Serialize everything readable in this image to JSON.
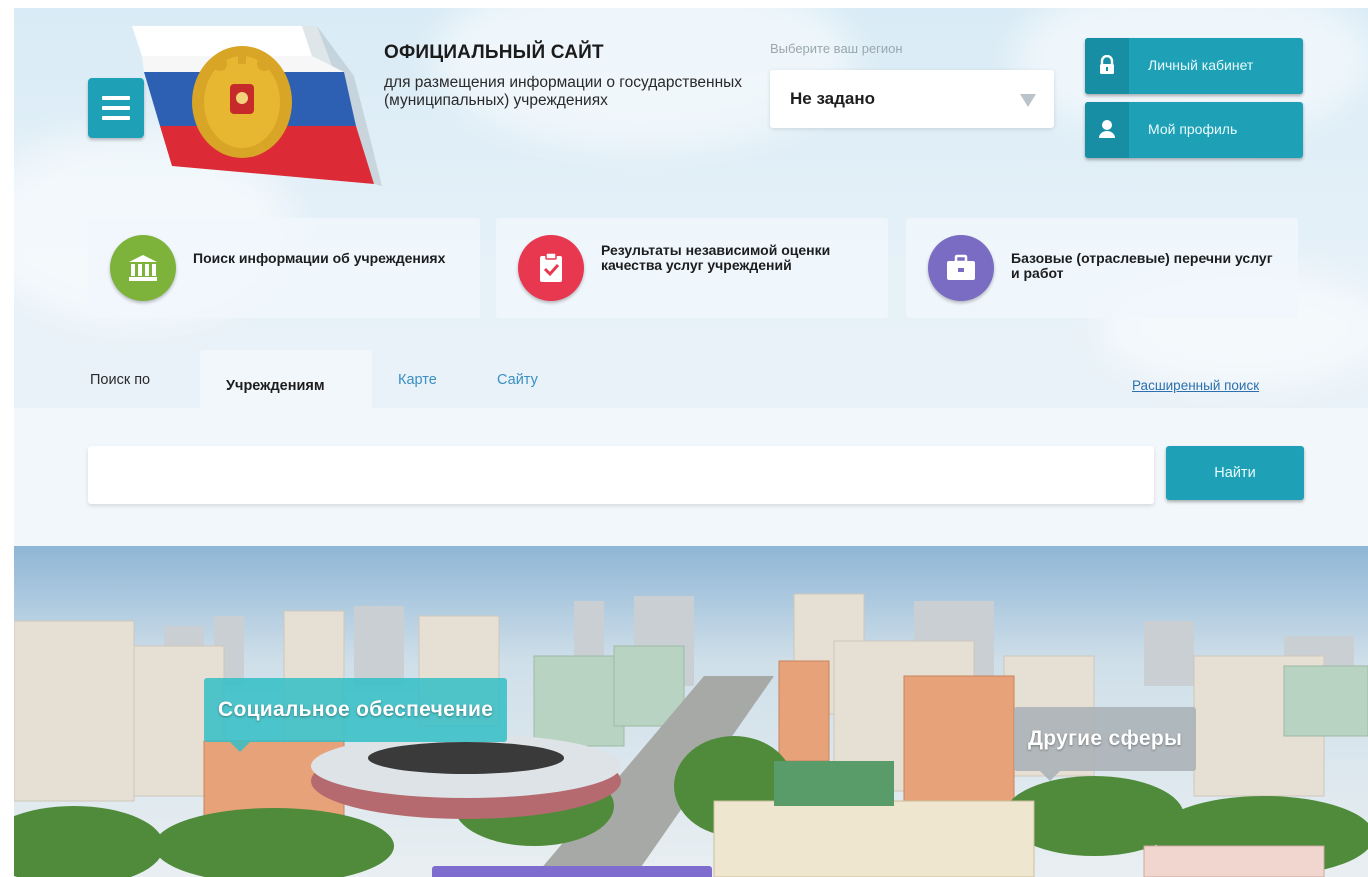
{
  "header": {
    "title": "ОФИЦИАЛЬНЫЙ САЙТ",
    "subtitle": "для размещения информации о государственных (муниципальных) учреждениях",
    "region_label": "Выберите ваш регион",
    "region_value": "Не задано",
    "cabinet_label": "Личный кабинет",
    "profile_label": "Мой профиль"
  },
  "cards": [
    {
      "label": "Поиск информации об учреждениях",
      "icon": "institution-icon",
      "color": "#7db33a"
    },
    {
      "label": "Результаты независимой оценки качества услуг учреждений",
      "icon": "clipboard-check-icon",
      "color": "#e8384f"
    },
    {
      "label": "Базовые (отраслевые) перечни услуг и работ",
      "icon": "briefcase-icon",
      "color": "#7a6cc2"
    }
  ],
  "search": {
    "prefix": "Поиск по",
    "tabs": [
      "Учреждениям",
      "Карте",
      "Сайту"
    ],
    "advanced_link": "Расширенный поиск",
    "input_value": "",
    "button_label": "Найти"
  },
  "banner": {
    "tags": [
      "Социальное обеспечение",
      "Другие сферы"
    ]
  },
  "colors": {
    "accent": "#1ea1b7",
    "link": "#3b8fc2"
  }
}
